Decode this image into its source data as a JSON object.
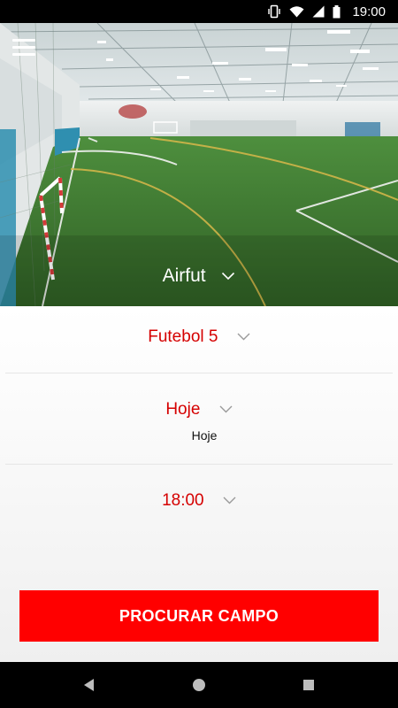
{
  "status_bar": {
    "time": "19:00",
    "icons": [
      "vibrate-icon",
      "wifi-icon",
      "signal-icon",
      "battery-icon"
    ]
  },
  "hero": {
    "venue_name": "Airfut",
    "menu_icon": "hamburger-menu-icon"
  },
  "form": {
    "sport": "Futebol 5",
    "day": "Hoje",
    "day_sub": "Hoje",
    "time": "18:00",
    "search_label": "PROCURAR CAMPO"
  },
  "nav": {
    "icons": [
      "back-icon",
      "home-icon",
      "recents-icon"
    ]
  },
  "colors": {
    "accent": "#ff0000",
    "selector_text": "#d50000",
    "status_bar": "#000000"
  }
}
